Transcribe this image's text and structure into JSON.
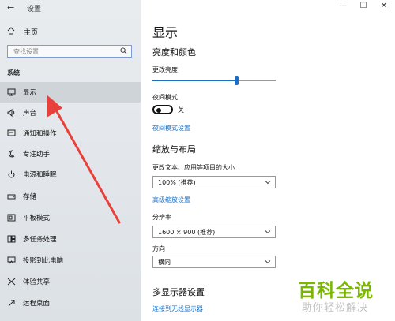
{
  "window": {
    "title": "设置",
    "minimize": "—",
    "maximize": "☐",
    "close": "✕"
  },
  "sidebar": {
    "back_icon": "arrow-left-icon",
    "home_label": "主页",
    "search_placeholder": "查找设置",
    "section_label": "系统",
    "items": [
      {
        "label": "显示",
        "icon": "monitor-icon",
        "selected": true
      },
      {
        "label": "声音",
        "icon": "speaker-icon"
      },
      {
        "label": "通知和操作",
        "icon": "notification-icon"
      },
      {
        "label": "专注助手",
        "icon": "moon-icon"
      },
      {
        "label": "电源和睡眠",
        "icon": "power-icon"
      },
      {
        "label": "存储",
        "icon": "storage-icon"
      },
      {
        "label": "平板模式",
        "icon": "tablet-icon"
      },
      {
        "label": "多任务处理",
        "icon": "multitask-icon"
      },
      {
        "label": "投影到此电脑",
        "icon": "project-icon"
      },
      {
        "label": "体验共享",
        "icon": "share-icon"
      },
      {
        "label": "远程桌面",
        "icon": "remote-icon"
      }
    ]
  },
  "main": {
    "title": "显示",
    "brightness_section": "亮度和颜色",
    "brightness_label": "更改亮度",
    "brightness_value": 0.68,
    "night_mode_label": "夜间模式",
    "night_mode_state": "关",
    "night_mode_link": "夜间模式设置",
    "scale_section": "缩放与布局",
    "scale_label": "更改文本、应用等项目的大小",
    "scale_value": "100% (推荐)",
    "advanced_scale_link": "高级缩放设置",
    "resolution_label": "分辨率",
    "resolution_value": "1600 × 900 (推荐)",
    "orientation_label": "方向",
    "orientation_value": "横向",
    "multi_display_section": "多显示器设置",
    "wireless_link": "连接到无线显示器"
  },
  "watermark": {
    "title": "百科全说",
    "subtitle": "助你轻松解决"
  },
  "colors": {
    "accent": "#1a6fc4",
    "annotation": "#e8403a",
    "watermark": "#7ab800"
  }
}
